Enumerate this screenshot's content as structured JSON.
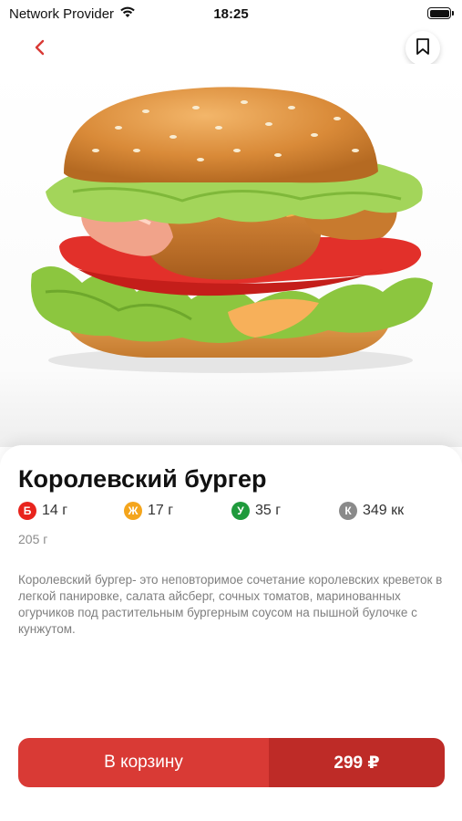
{
  "status_bar": {
    "carrier": "Network Provider",
    "time": "18:25"
  },
  "header": {
    "back_icon": "chevron-left-icon",
    "bookmark_icon": "bookmark-icon"
  },
  "product": {
    "image_icon": "burger-image",
    "title": "Королевский бургер",
    "nutrition": [
      {
        "badge": "Б",
        "value": "14 г",
        "color": "#e8241d"
      },
      {
        "badge": "Ж",
        "value": "17 г",
        "color": "#f4a51c"
      },
      {
        "badge": "У",
        "value": "35 г",
        "color": "#1f9a3c"
      },
      {
        "badge": "К",
        "value": "349 кк",
        "color": "#8a8a8a"
      }
    ],
    "weight": "205 г",
    "description": "Королевский бургер- это неповторимое сочетание королевских креветок в легкой панировке, салата айсберг, сочных томатов, маринованных огурчиков под растительным бургерным соусом на пышной булочке с кунжутом."
  },
  "cart": {
    "label": "В корзину",
    "price": "299 ₽"
  },
  "colors": {
    "accent": "#d93a35",
    "accent_dark": "#be2b27"
  }
}
